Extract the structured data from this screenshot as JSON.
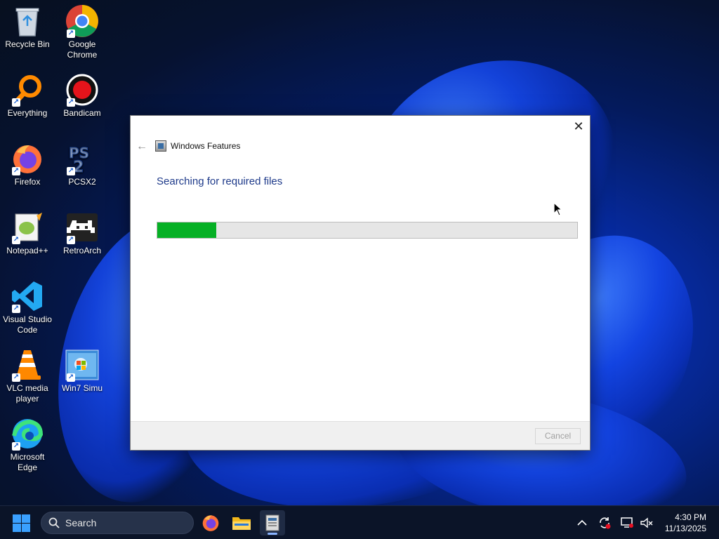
{
  "desktop": {
    "icons": [
      {
        "label": "Recycle Bin",
        "icon": "recycle-bin-icon",
        "shortcut": false
      },
      {
        "label": "Google Chrome",
        "icon": "chrome-icon",
        "shortcut": true
      },
      {
        "label": "Everything",
        "icon": "everything-icon",
        "shortcut": true
      },
      {
        "label": "Bandicam",
        "icon": "bandicam-icon",
        "shortcut": true
      },
      {
        "label": "Firefox",
        "icon": "firefox-icon",
        "shortcut": true
      },
      {
        "label": "PCSX2",
        "icon": "pcsx2-icon",
        "shortcut": true
      },
      {
        "label": "Notepad++",
        "icon": "notepad-plus-plus-icon",
        "shortcut": true
      },
      {
        "label": "RetroArch",
        "icon": "retroarch-icon",
        "shortcut": true
      },
      {
        "label": "Visual Studio Code",
        "icon": "vscode-icon",
        "shortcut": true
      },
      {
        "label": "VLC media player",
        "icon": "vlc-icon",
        "shortcut": true
      },
      {
        "label": "Win7 Simu",
        "icon": "win7-simu-icon",
        "shortcut": true
      },
      {
        "label": "Microsoft Edge",
        "icon": "edge-icon",
        "shortcut": true
      }
    ]
  },
  "dialog": {
    "title": "Windows Features",
    "heading": "Searching for required files",
    "progress_percent": 14,
    "progress_color": "#06b025",
    "cancel_label": "Cancel",
    "close_glyph": "✕",
    "back_glyph": "←"
  },
  "taskbar": {
    "search_placeholder": "Search",
    "apps": [
      "firefox-icon",
      "file-explorer-icon",
      "windows-features-icon"
    ],
    "active_app": "windows-features-icon",
    "tray": [
      "chevron-up-icon",
      "sync-icon",
      "display-icon",
      "volume-muted-icon"
    ],
    "time": "4:30 PM",
    "date": "11/13/2025"
  },
  "colors": {
    "accent": "#3aa0ff",
    "heading": "#1e3a8a",
    "taskbar": "#0b1428"
  }
}
